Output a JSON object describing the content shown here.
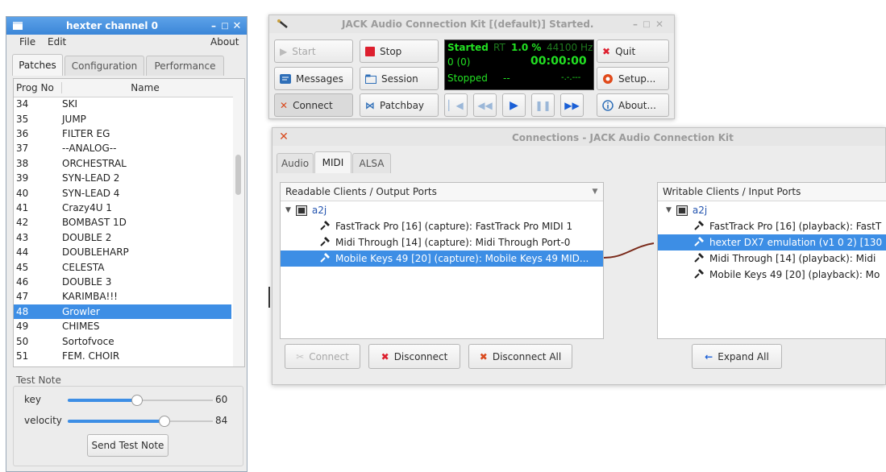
{
  "hexter": {
    "title": "hexter channel 0",
    "menu": {
      "file": "File",
      "edit": "Edit",
      "about": "About"
    },
    "tabs": [
      "Patches",
      "Configuration",
      "Performance"
    ],
    "columns": {
      "prog": "Prog No",
      "name": "Name"
    },
    "patches": [
      {
        "no": "34",
        "name": "SKI"
      },
      {
        "no": "35",
        "name": "JUMP"
      },
      {
        "no": "36",
        "name": "FILTER EG"
      },
      {
        "no": "37",
        "name": "--ANALOG--"
      },
      {
        "no": "38",
        "name": "ORCHESTRAL"
      },
      {
        "no": "39",
        "name": "SYN-LEAD 2"
      },
      {
        "no": "40",
        "name": "SYN-LEAD 4"
      },
      {
        "no": "41",
        "name": "Crazy4U 1"
      },
      {
        "no": "42",
        "name": "BOMBAST 1D"
      },
      {
        "no": "43",
        "name": "DOUBLE 2"
      },
      {
        "no": "44",
        "name": "DOUBLEHARP"
      },
      {
        "no": "45",
        "name": "CELESTA"
      },
      {
        "no": "46",
        "name": "DOUBLE 3"
      },
      {
        "no": "47",
        "name": "KARIMBA!!!"
      },
      {
        "no": "48",
        "name": "Growler"
      },
      {
        "no": "49",
        "name": "CHIMES"
      },
      {
        "no": "50",
        "name": "Sortofvoce"
      },
      {
        "no": "51",
        "name": "FEM. CHOIR"
      }
    ],
    "selected_patch": "48",
    "test_note": {
      "group_label": "Test Note",
      "key_label": "key",
      "key_value": "60",
      "key_fraction": 0.47,
      "velocity_label": "velocity",
      "velocity_value": "84",
      "velocity_fraction": 0.66,
      "send_button": "Send Test Note"
    }
  },
  "jack": {
    "title": "JACK Audio Connection Kit [(default)] Started.",
    "buttons": {
      "start": "Start",
      "stop": "Stop",
      "quit": "Quit",
      "messages": "Messages",
      "session": "Session",
      "setup": "Setup...",
      "connect": "Connect",
      "patchbay": "Patchbay",
      "about": "About..."
    },
    "lcd": {
      "status": "Started",
      "rt": "RT",
      "dsp": "1.0 %",
      "rate": "44100 Hz",
      "xruns": "0 (0)",
      "time": "00:00:00",
      "transport": "Stopped",
      "dash": "--",
      "bbt": "-.-.---"
    },
    "colors": {
      "lcd_bg": "#000000",
      "lcd_green": "#22e022",
      "lcd_dim_green": "#1f7a1f"
    }
  },
  "connections": {
    "title": "Connections - JACK Audio Connection Kit",
    "tabs": [
      "Audio",
      "MIDI",
      "ALSA"
    ],
    "readable_header": "Readable Clients / Output Ports",
    "writable_header": "Writable Clients / Input Ports",
    "client": "a2j",
    "outputs": [
      "FastTrack Pro [16] (capture): FastTrack Pro MIDI 1",
      "Midi Through [14] (capture): Midi Through Port-0",
      "Mobile Keys 49 [20] (capture): Mobile Keys 49 MID..."
    ],
    "inputs": [
      "FastTrack Pro [16] (playback): FastT",
      "hexter DX7 emulation (v1 0 2) [130",
      "Midi Through [14] (playback): Midi",
      "Mobile Keys 49 [20] (playback): Mo"
    ],
    "buttons": {
      "connect": "Connect",
      "disconnect": "Disconnect",
      "disconnect_all": "Disconnect All",
      "expand_all": "Expand All"
    },
    "colors": {
      "selection": "#3d8ee5",
      "wire": "#7a2a1a"
    }
  }
}
